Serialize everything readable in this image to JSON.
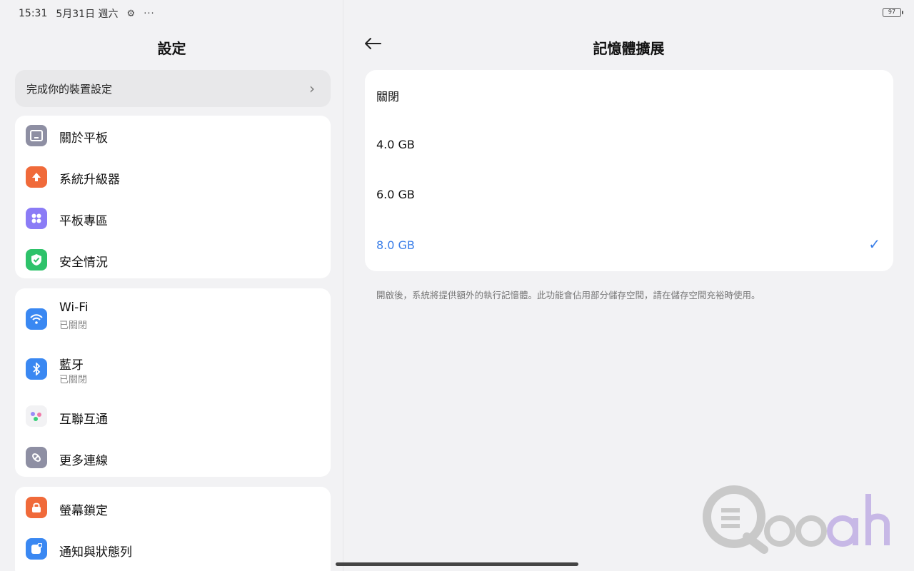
{
  "status": {
    "time": "15:31",
    "date": "5月31日 週六",
    "more": "···",
    "battery": "97"
  },
  "left": {
    "title": "設定",
    "setup": "完成你的裝置設定",
    "group1": [
      {
        "label": "關於平板",
        "icon": "tablet-icon",
        "color": "#8e8fa3"
      },
      {
        "label": "系統升級器",
        "icon": "upgrade-arrow-icon",
        "color": "#f06a3a"
      },
      {
        "label": "平板專區",
        "icon": "grid-dots-icon",
        "color": "#8b7cf6"
      },
      {
        "label": "安全情況",
        "icon": "shield-check-icon",
        "color": "#2ec26a"
      }
    ],
    "group2": [
      {
        "label": "Wi-Fi",
        "sub": "已關閉",
        "icon": "wifi-icon",
        "color": "#3a88f2"
      },
      {
        "label": "藍牙",
        "sub": "已關閉",
        "icon": "bluetooth-icon",
        "color": "#3a88f2"
      },
      {
        "label": "互聯互通",
        "icon": "interconnect-dots-icon",
        "color": "#f2f2f4"
      },
      {
        "label": "更多連線",
        "icon": "link-icon",
        "color": "#8e8fa3"
      }
    ],
    "group3": [
      {
        "label": "螢幕鎖定",
        "icon": "lock-icon",
        "color": "#f06a3a"
      },
      {
        "label": "通知與狀態列",
        "icon": "notification-icon",
        "color": "#3a88f2"
      }
    ]
  },
  "right": {
    "title": "記憶體擴展",
    "options": [
      "關閉",
      "4.0 GB",
      "6.0 GB",
      "8.0 GB"
    ],
    "selected_index": 3,
    "check": "✓",
    "note": "開啟後，系統將提供額外的執行記憶體。此功能會佔用部分儲存空間，請在儲存空間充裕時使用。"
  },
  "watermark": "Qooah",
  "colors": {
    "accent": "#3a7ee8",
    "background": "#f2f2f4",
    "card": "#ffffff"
  }
}
